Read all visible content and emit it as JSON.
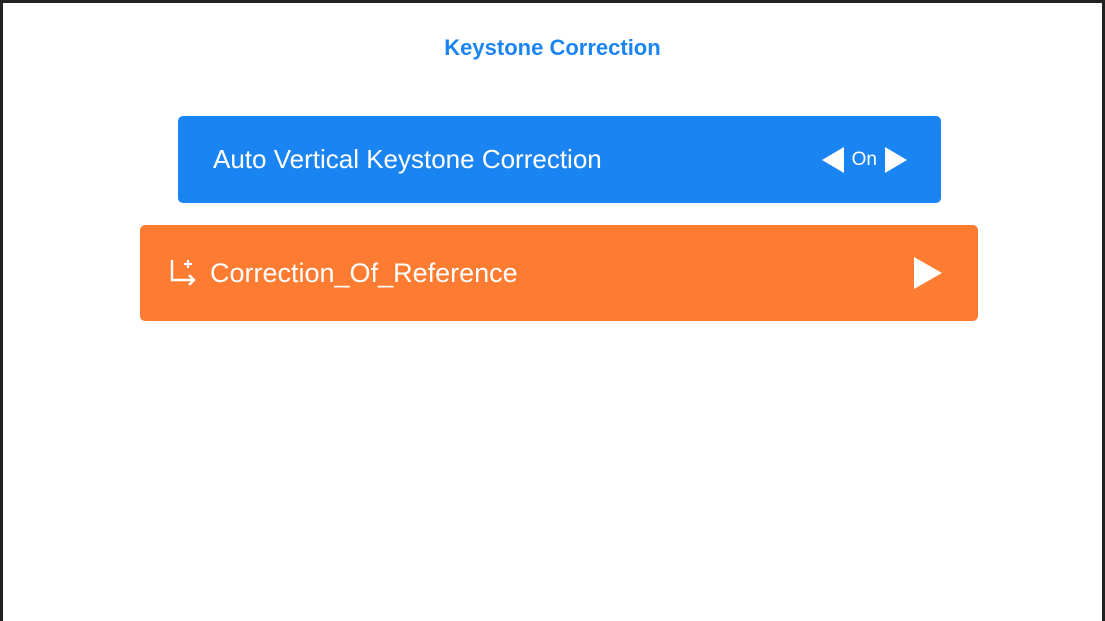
{
  "page": {
    "title": "Keystone Correction"
  },
  "menu": {
    "items": [
      {
        "label": "Auto Vertical Keystone Correction",
        "value": "On",
        "color": "#1a85f2",
        "left_arrow_icon": "triangle-left-icon",
        "right_arrow_icon": "triangle-right-icon"
      },
      {
        "label": "Correction_Of_Reference",
        "color": "#fd7c31",
        "icon": "reference-corner-arrow-icon",
        "right_arrow_icon": "triangle-right-icon"
      }
    ]
  },
  "colors": {
    "title": "#1a85f2",
    "border": "#222222",
    "background": "#ffffff"
  }
}
